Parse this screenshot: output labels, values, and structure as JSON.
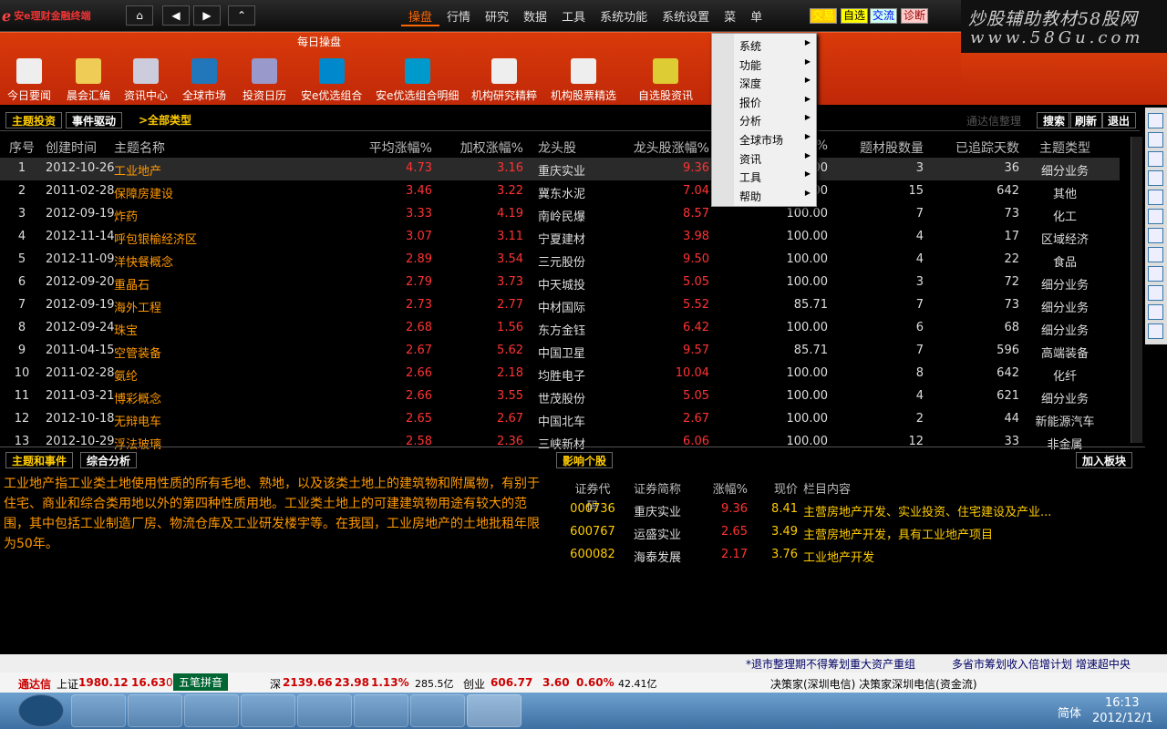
{
  "app": {
    "title": "安e理财金融终端"
  },
  "menu": [
    "操盘",
    "行情",
    "研究",
    "数据",
    "工具",
    "系统功能",
    "系统设置",
    "菜",
    "单"
  ],
  "tags": [
    {
      "t": "交易",
      "c": "#ff0",
      "bg": "#fc0"
    },
    {
      "t": "自选",
      "c": "#000",
      "bg": "#ff0"
    },
    {
      "t": "交流",
      "c": "#00f",
      "bg": "#cfe"
    },
    {
      "t": "诊断",
      "c": "#900",
      "bg": "#fcc"
    }
  ],
  "brand": {
    "line1": "炒股辅助教材58股网",
    "line2": "www.58Gu.com"
  },
  "subtitle": "每日操盘",
  "toolbar": [
    "今日要闻",
    "晨会汇编",
    "资讯中心",
    "全球市场",
    "投资日历",
    "安e优选组合",
    "安e优选组合明细",
    "机构研究精粹",
    "机构股票精选",
    "自选股资讯"
  ],
  "tabs": {
    "t1": "主题投资",
    "t2": "事件驱动",
    "t3": ">全部类型",
    "tdtx": "通达信整理",
    "search": "搜索",
    "refresh": "刷新",
    "exit": "退出"
  },
  "headers": [
    "序号",
    "创建时间",
    "主题名称",
    "平均涨幅%",
    "加权涨幅%",
    "龙头股",
    "龙头股涨幅%",
    "%",
    "题材股数量",
    "已追踪天数",
    "主题类型"
  ],
  "rows": [
    [
      "1",
      "2012-10-26",
      "工业地产",
      "4.73",
      "3.16",
      "重庆实业",
      "9.36",
      "100.00",
      "3",
      "36",
      "细分业务"
    ],
    [
      "2",
      "2011-02-28",
      "保障房建设",
      "3.46",
      "3.22",
      "冀东水泥",
      "7.04",
      "100.00",
      "15",
      "642",
      "其他"
    ],
    [
      "3",
      "2012-09-19",
      "炸药",
      "3.33",
      "4.19",
      "南岭民爆",
      "8.57",
      "100.00",
      "7",
      "73",
      "化工"
    ],
    [
      "4",
      "2012-11-14",
      "呼包银榆经济区",
      "3.07",
      "3.11",
      "宁夏建材",
      "3.98",
      "100.00",
      "4",
      "17",
      "区域经济"
    ],
    [
      "5",
      "2012-11-09",
      "洋快餐概念",
      "2.89",
      "3.54",
      "三元股份",
      "9.50",
      "100.00",
      "4",
      "22",
      "食品"
    ],
    [
      "6",
      "2012-09-20",
      "重晶石",
      "2.79",
      "3.73",
      "中天城投",
      "5.05",
      "100.00",
      "3",
      "72",
      "细分业务"
    ],
    [
      "7",
      "2012-09-19",
      "海外工程",
      "2.73",
      "2.77",
      "中材国际",
      "5.52",
      "85.71",
      "7",
      "73",
      "细分业务"
    ],
    [
      "8",
      "2012-09-24",
      "珠宝",
      "2.68",
      "1.56",
      "东方金钰",
      "6.42",
      "100.00",
      "6",
      "68",
      "细分业务"
    ],
    [
      "9",
      "2011-04-15",
      "空管装备",
      "2.67",
      "5.62",
      "中国卫星",
      "9.57",
      "85.71",
      "7",
      "596",
      "高端装备"
    ],
    [
      "10",
      "2011-02-28",
      "氨纶",
      "2.66",
      "2.18",
      "均胜电子",
      "10.04",
      "100.00",
      "8",
      "642",
      "化纤"
    ],
    [
      "11",
      "2011-03-21",
      "博彩概念",
      "2.66",
      "3.55",
      "世茂股份",
      "5.05",
      "100.00",
      "4",
      "621",
      "细分业务"
    ],
    [
      "12",
      "2012-10-18",
      "无辩电车",
      "2.65",
      "2.67",
      "中国北车",
      "2.67",
      "100.00",
      "2",
      "44",
      "新能源汽车"
    ],
    [
      "13",
      "2012-10-29",
      "浮法玻璃",
      "2.58",
      "2.36",
      "三峡新材",
      "6.06",
      "100.00",
      "12",
      "33",
      "非金属"
    ]
  ],
  "lower": {
    "tab1": "主题和事件",
    "tab2": "综合分析",
    "tab3": "影响个股",
    "add": "加入板块",
    "desc": "工业地产指工业类土地使用性质的所有毛地、熟地，以及该类土地上的建筑物和附属物，有别于住宅、商业和综合类用地以外的第四种性质用地。工业类土地上的可建建筑物用途有较大的范围，其中包括工业制造厂房、物流仓库及工业研发楼宇等。在我国，工业房地产的土地批租年限为50年。",
    "mhead": [
      "证券代码",
      "证券简称",
      "涨幅%",
      "现价",
      "栏目内容"
    ],
    "mrows": [
      [
        "000736",
        "重庆实业",
        "9.36",
        "8.41",
        "主营房地产开发、实业投资、住宅建设及产业..."
      ],
      [
        "600767",
        "运盛实业",
        "2.65",
        "3.49",
        "主营房地产开发，具有工业地产项目"
      ],
      [
        "600082",
        "海泰发展",
        "2.17",
        "3.76",
        "工业地产开发"
      ]
    ]
  },
  "ticker": {
    "a": "*退市整理期不得筹划重大资产重组",
    "b": "多省市筹划收入倍增计划 增速超中央"
  },
  "index": {
    "brand": "通达信",
    "sh": "上证",
    "shv": "1980.12",
    "shc": "16.63",
    "shp": "0",
    "ime": "五笔拼音",
    "sz": "深",
    "szv": "2139.66",
    "szc": "23.98",
    "szp": "1.13%",
    "szvol": "285.5亿",
    "cy": "创业",
    "cyv": "606.77",
    "cyc": "3.60",
    "cyp": "0.60%",
    "cyvol": "42.41亿",
    "news": "决策家(深圳电信) 决策家深圳电信(资金流)"
  },
  "clock": {
    "time": "16:13",
    "date": "2012/12/1",
    "lang": "简体"
  },
  "dropdown": [
    "系统",
    "功能",
    "深度",
    "报价",
    "分析",
    "全球市场",
    "资讯",
    "工具",
    "帮助"
  ]
}
